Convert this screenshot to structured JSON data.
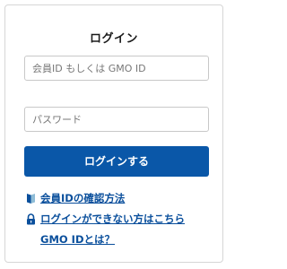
{
  "login": {
    "title": "ログイン",
    "id_placeholder": "会員ID もしくは GMO ID",
    "password_placeholder": "パスワード",
    "submit_label": "ログインする"
  },
  "links": {
    "confirm_id": "会員IDの確認方法",
    "cannot_login": "ログインができない方はこちら",
    "what_is_gmo_id": "GMO IDとは？"
  },
  "colors": {
    "accent": "#0a57a8",
    "link": "#0a4f9c"
  },
  "icons": {
    "confirm_id_icon": "id-card-icon",
    "cannot_login_icon": "lock-icon"
  }
}
